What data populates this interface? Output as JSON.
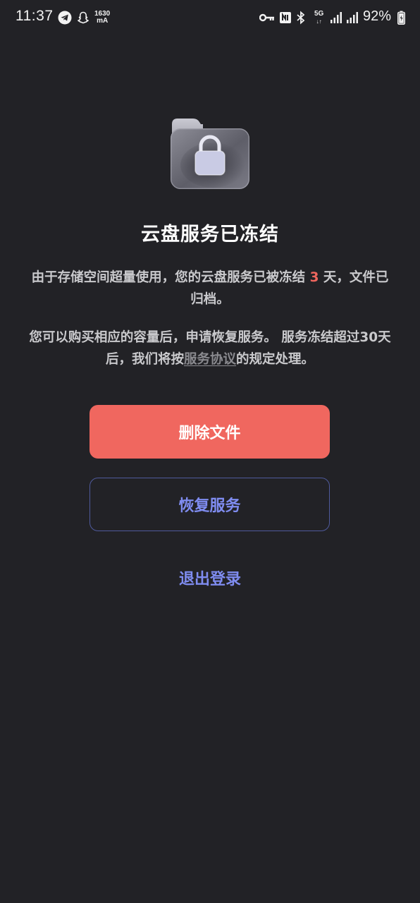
{
  "status_bar": {
    "time": "11:37",
    "current_value": "1630",
    "current_unit": "mA",
    "network_type": "5G",
    "battery": "92%",
    "icons": [
      "telegram-icon",
      "snapchat-ghost-icon",
      "key-icon",
      "nfc-icon",
      "bluetooth-icon",
      "signal-icon",
      "signal-icon",
      "battery-charging-icon"
    ]
  },
  "illustration": {
    "icon": "locked-folder-icon"
  },
  "main": {
    "title": "云盘服务已冻结",
    "desc1_before": "由于存储空间超量使用，您的云盘服务已被冻结",
    "desc1_days": "3",
    "desc1_after": "天，文件已归档。",
    "desc2_before": "您可以购买相应的容量后，申请恢复服务。 服务冻结超过30天后，我们将按",
    "desc2_link": "服务协议",
    "desc2_after": "的规定处理。"
  },
  "buttons": {
    "delete_label": "删除文件",
    "restore_label": "恢复服务",
    "logout_label": "退出登录"
  },
  "colors": {
    "background": "#222226",
    "danger": "#f0675f",
    "accent": "#7f8cf0"
  }
}
